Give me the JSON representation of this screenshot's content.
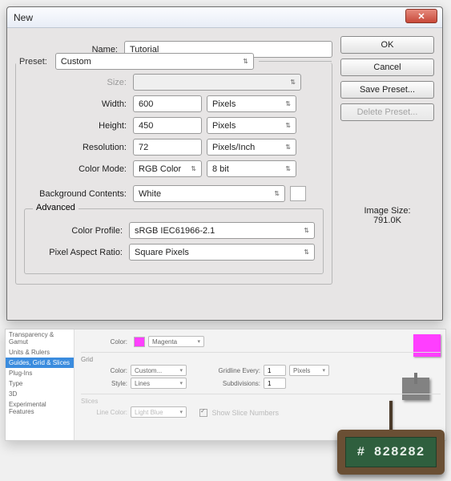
{
  "dialog": {
    "title": "New",
    "fields": {
      "name_label": "Name:",
      "name_value": "Tutorial",
      "preset_label": "Preset:",
      "preset_value": "Custom",
      "size_label": "Size:",
      "width_label": "Width:",
      "width_value": "600",
      "width_unit": "Pixels",
      "height_label": "Height:",
      "height_value": "450",
      "height_unit": "Pixels",
      "resolution_label": "Resolution:",
      "resolution_value": "72",
      "resolution_unit": "Pixels/Inch",
      "colormode_label": "Color Mode:",
      "colormode_value": "RGB Color",
      "colormode_depth": "8 bit",
      "bg_label": "Background Contents:",
      "bg_value": "White"
    },
    "advanced": {
      "legend": "Advanced",
      "profile_label": "Color Profile:",
      "profile_value": "sRGB IEC61966-2.1",
      "par_label": "Pixel Aspect Ratio:",
      "par_value": "Square Pixels"
    },
    "buttons": {
      "ok": "OK",
      "cancel": "Cancel",
      "save_preset": "Save Preset...",
      "delete_preset": "Delete Preset..."
    },
    "image_size_label": "Image Size:",
    "image_size_value": "791.0K"
  },
  "prefs": {
    "sidebar": [
      "Transparency & Gamut",
      "Units & Rulers",
      "Guides, Grid & Slices",
      "Plug-Ins",
      "Type",
      "3D",
      "Experimental Features"
    ],
    "selected_index": 2,
    "color_label": "Color:",
    "color_value": "Magenta",
    "grid_header": "Grid",
    "grid_color_label": "Color:",
    "grid_color_value": "Custom...",
    "gridline_label": "Gridline Every:",
    "gridline_value": "1",
    "gridline_unit": "Pixels",
    "style_label": "Style:",
    "style_value": "Lines",
    "subdiv_label": "Subdivisions:",
    "subdiv_value": "1",
    "slices_header": "Slices",
    "line_color_label": "Line Color:",
    "line_color_value": "Light Blue",
    "show_slice_label": "Show Slice Numbers"
  },
  "callout": "# 828282"
}
